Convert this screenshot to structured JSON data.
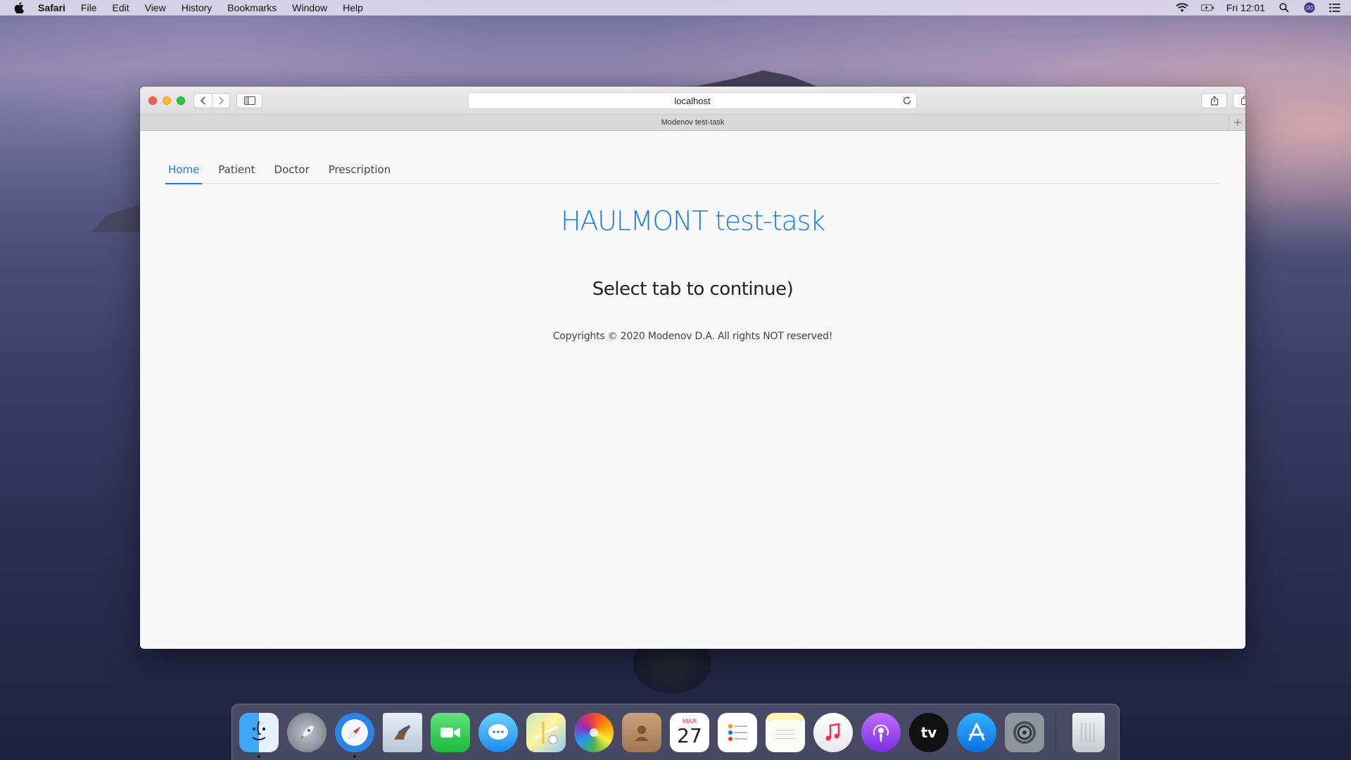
{
  "menubar": {
    "app_name": "Safari",
    "items": [
      "File",
      "Edit",
      "View",
      "History",
      "Bookmarks",
      "Window",
      "Help"
    ],
    "clock": "Fri 12:01"
  },
  "browser": {
    "url": "localhost",
    "tab_title": "Modenov test-task"
  },
  "page": {
    "nav_tabs": [
      "Home",
      "Patient",
      "Doctor",
      "Prescription"
    ],
    "active_tab": "Home",
    "title": "HAULMONT test-task",
    "subtitle": "Select tab to continue)",
    "footer": "Copyrights © 2020 Modenov D.A. All rights NOT reserved!",
    "accent_color": "#197de1"
  },
  "dock": {
    "apps": [
      "Finder",
      "Launchpad",
      "Safari",
      "Mail",
      "FaceTime",
      "Messages",
      "Maps",
      "Photos",
      "Contacts",
      "Calendar",
      "Reminders",
      "Notes",
      "Music",
      "Podcasts",
      "TV",
      "App Store",
      "System Preferences",
      "Trash"
    ],
    "calendar_month": "MAR",
    "calendar_day": "27",
    "tv_label": "tv"
  }
}
